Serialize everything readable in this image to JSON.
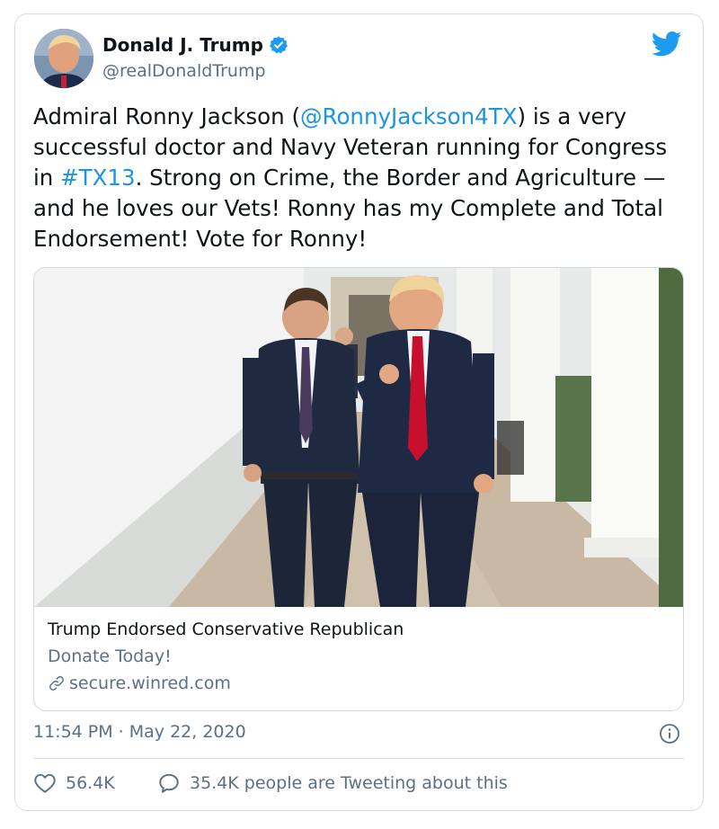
{
  "author": {
    "name": "Donald J. Trump",
    "handle": "@realDonaldTrump",
    "verified": true,
    "avatar_icon": "user-avatar"
  },
  "tweet": {
    "text_parts": [
      {
        "text": "Admiral Ronny Jackson (",
        "link": false
      },
      {
        "text": "@RonnyJackson4TX",
        "link": true
      },
      {
        "text": ") is a very successful doctor and Navy Veteran running for Congress in ",
        "link": false
      },
      {
        "text": "#TX13",
        "link": true
      },
      {
        "text": ". Strong on Crime, the Border and Agriculture — and he loves our Vets! Ronny has my Complete and Total Endorsement! Vote for Ronny!",
        "link": false
      }
    ]
  },
  "link_card": {
    "title": "Trump Endorsed Conservative Republican",
    "description": "Donate Today!",
    "domain": "secure.winred.com"
  },
  "meta": {
    "timestamp": "11:54 PM · May 22, 2020"
  },
  "actions": {
    "likes": "56.4K",
    "conversation": "35.4K people are Tweeting about this"
  },
  "colors": {
    "link": "#1b95e0",
    "muted": "#5b7083",
    "border": "#d6dee3",
    "brand": "#1d9bf0"
  }
}
